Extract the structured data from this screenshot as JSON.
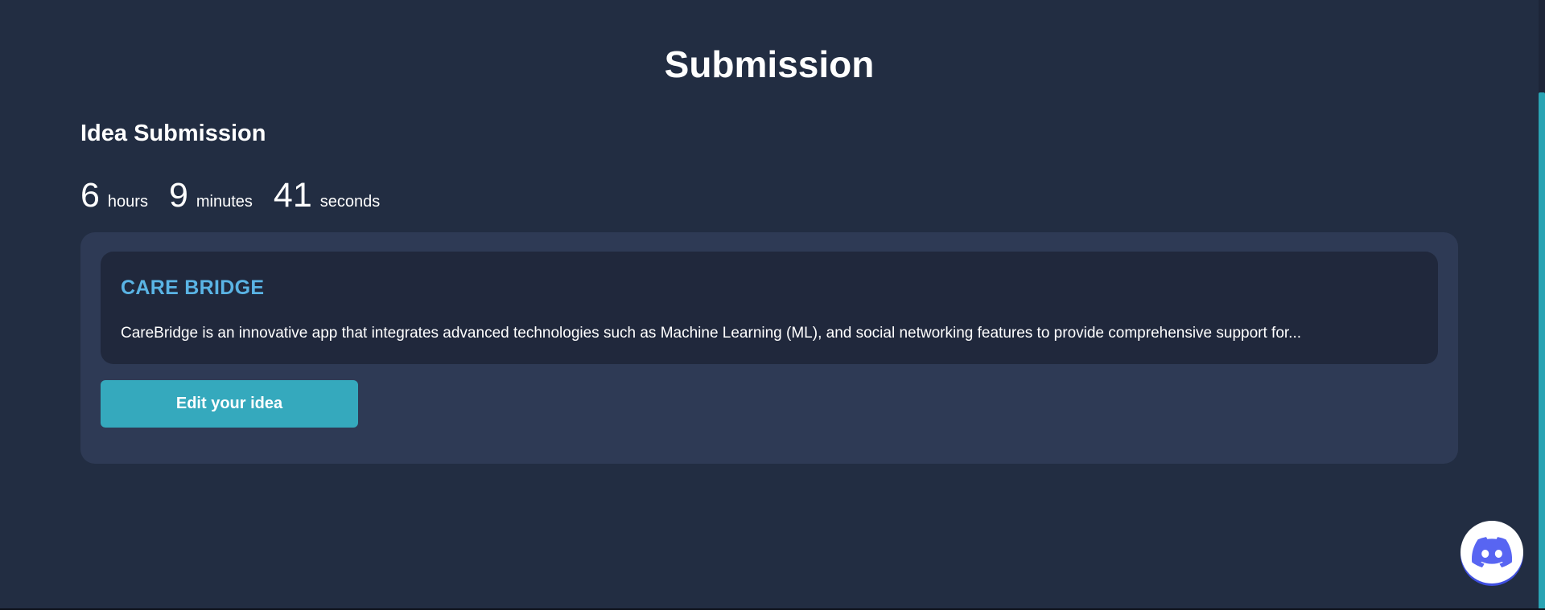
{
  "page": {
    "title": "Submission"
  },
  "section": {
    "title": "Idea Submission"
  },
  "countdown": {
    "hours_value": "6",
    "hours_label": "hours",
    "minutes_value": "9",
    "minutes_label": "minutes",
    "seconds_value": "41",
    "seconds_label": "seconds"
  },
  "idea": {
    "title": "CARE BRIDGE",
    "description": "CareBridge is an innovative app that integrates advanced technologies such as Machine Learning (ML), and social networking features to provide comprehensive support for..."
  },
  "actions": {
    "edit_label": "Edit your idea"
  },
  "floating": {
    "discord_icon": "discord-icon"
  },
  "colors": {
    "background": "#222d42",
    "panel": "#2e3a55",
    "card": "#20283c",
    "accent_title": "#5ab4e5",
    "button": "#35a9bd",
    "discord_blurple": "#5865f2"
  }
}
